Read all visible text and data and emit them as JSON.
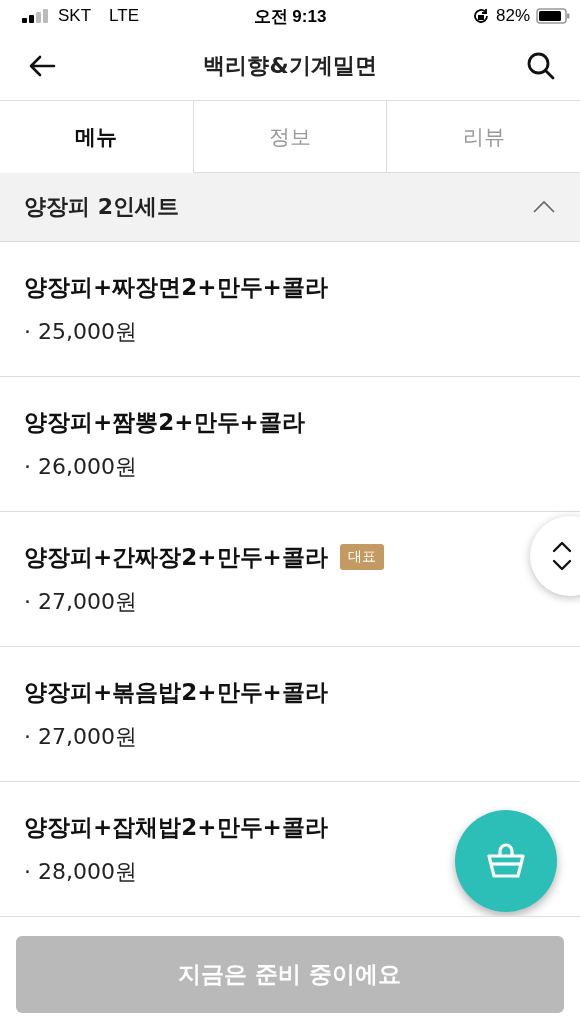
{
  "status_bar": {
    "carrier": "SKT",
    "network": "LTE",
    "time": "오전 9:13",
    "battery": "82%"
  },
  "header": {
    "title": "백리향&기계밀면"
  },
  "tabs": [
    {
      "label": "메뉴",
      "selected": true
    },
    {
      "label": "정보",
      "selected": false
    },
    {
      "label": "리뷰",
      "selected": false
    }
  ],
  "section": {
    "title": "양장피 2인세트",
    "expanded": true
  },
  "items": [
    {
      "name": "양장피+짜장면2+만두+콜라",
      "price": "· 25,000원"
    },
    {
      "name": "양장피+짬뽕2+만두+콜라",
      "price": "· 26,000원"
    },
    {
      "name": "양장피+간짜장2+만두+콜라",
      "price": "· 27,000원",
      "badge": "대표"
    },
    {
      "name": "양장피+볶음밥2+만두+콜라",
      "price": "· 27,000원"
    },
    {
      "name": "양장피+잡채밥2+만두+콜라",
      "price": "· 28,000원"
    }
  ],
  "order_button": {
    "label": "지금은 준비 중이에요",
    "disabled": true
  }
}
